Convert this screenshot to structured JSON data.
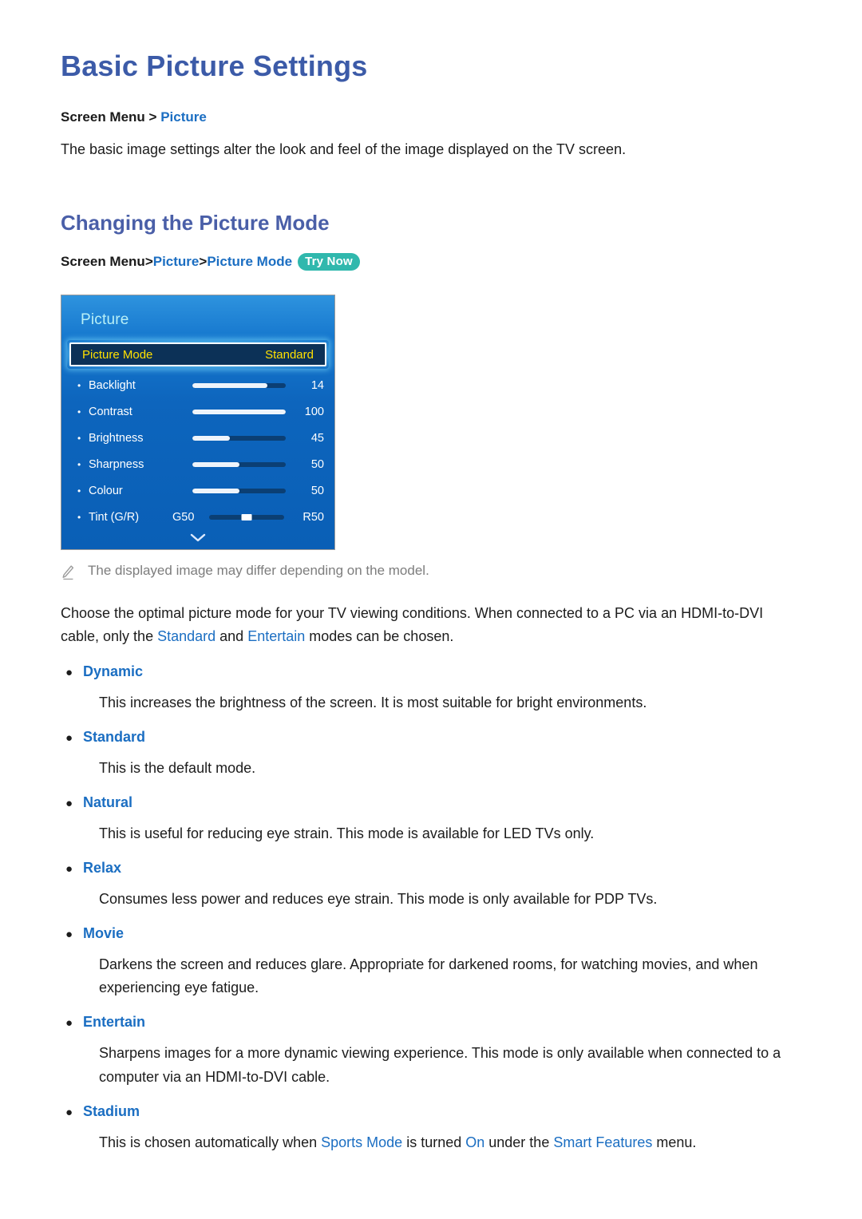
{
  "page_title": "Basic Picture Settings",
  "breadcrumb_top": {
    "prefix": "Screen Menu",
    "sep": ">",
    "link": "Picture"
  },
  "intro": "The basic image settings alter the look and feel of the image displayed on the TV screen.",
  "section_heading": "Changing the Picture Mode",
  "breadcrumb_section": {
    "prefix": "Screen Menu",
    "sep1": ">",
    "link1": "Picture",
    "sep2": ">",
    "link2": "Picture Mode",
    "badge": "Try Now"
  },
  "tv_menu": {
    "title": "Picture",
    "highlighted": {
      "label": "Picture Mode",
      "value": "Standard"
    },
    "rows": [
      {
        "label": "Backlight",
        "value": "14",
        "fill_percent": 80
      },
      {
        "label": "Contrast",
        "value": "100",
        "fill_percent": 100
      },
      {
        "label": "Brightness",
        "value": "45",
        "fill_percent": 40
      },
      {
        "label": "Sharpness",
        "value": "50",
        "fill_percent": 50
      },
      {
        "label": "Colour",
        "value": "50",
        "fill_percent": 50
      }
    ],
    "tint_row": {
      "label": "Tint (G/R)",
      "left_label": "G50",
      "right_label": "R50",
      "marker_percent": 50
    },
    "more_icon": "chevron-down-icon",
    "colors": {
      "panel_top": "#2e93de",
      "panel_bottom": "#0a5fb6",
      "highlight_bg": "#0c3157",
      "highlight_text": "#ffe000",
      "title_text": "#b8f0f7",
      "slider_fill": "#eef4fb",
      "slider_track": "#0b3f74"
    }
  },
  "note": {
    "icon": "pencil-icon",
    "text": "The displayed image may differ depending on the model."
  },
  "body_paragraph": {
    "part1": "Choose the optimal picture mode for your TV viewing conditions. When connected to a PC via an HDMI-to-DVI cable, only the ",
    "hl1": "Standard",
    "part2": " and ",
    "hl2": "Entertain",
    "part3": " modes can be chosen."
  },
  "modes": [
    {
      "name": "Dynamic",
      "description": "This increases the brightness of the screen. It is most suitable for bright environments."
    },
    {
      "name": "Standard",
      "description": "This is the default mode."
    },
    {
      "name": "Natural",
      "description": "This is useful for reducing eye strain. This mode is available for LED TVs only."
    },
    {
      "name": "Relax",
      "description": "Consumes less power and reduces eye strain. This mode is only available for PDP TVs."
    },
    {
      "name": "Movie",
      "description": "Darkens the screen and reduces glare. Appropriate for darkened rooms, for watching movies, and when experiencing eye fatigue."
    },
    {
      "name": "Entertain",
      "description": "Sharpens images for a more dynamic viewing experience. This mode is only available when connected to a computer via an HDMI-to-DVI cable."
    },
    {
      "name": "Stadium",
      "description": null
    }
  ],
  "stadium_desc": {
    "part1": "This is chosen automatically when ",
    "hl1": "Sports Mode",
    "part2": " is turned ",
    "hl2": "On",
    "part3": " under the ",
    "hl3": "Smart Features",
    "part4": " menu."
  },
  "accent_colors": {
    "title_blue": "#3c5ba8",
    "heading_blue": "#4a5fa8",
    "link_blue": "#1b6ec2",
    "badge_teal": "#30b8ad"
  }
}
